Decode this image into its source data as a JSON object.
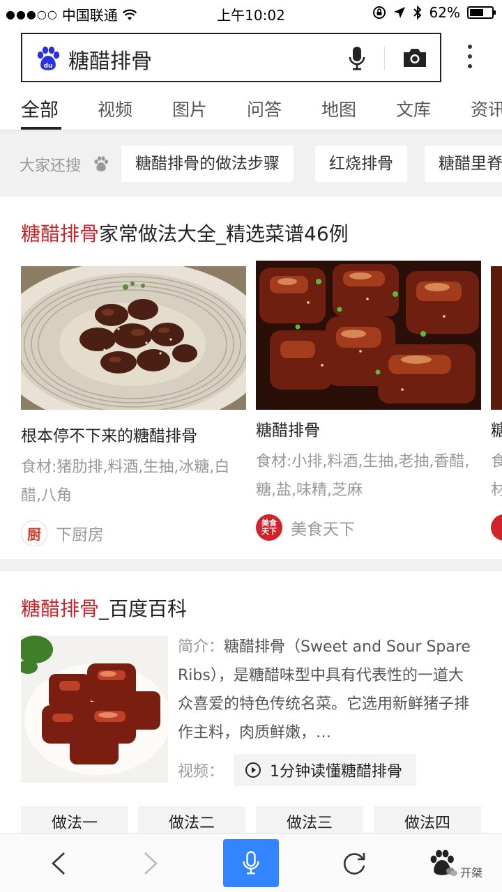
{
  "status_bar": {
    "carrier": "中国联通",
    "time": "上午10:02",
    "battery": "62%",
    "battery_level": 0.62
  },
  "search": {
    "query": "糖醋排骨"
  },
  "tabs": [
    "全部",
    "视频",
    "图片",
    "问答",
    "地图",
    "文库",
    "资讯"
  ],
  "active_tab": 0,
  "suggestions": {
    "label": "大家还搜",
    "items": [
      "糖醋排骨的做法步骤",
      "红烧排骨",
      "糖醋里脊"
    ]
  },
  "recipes_card": {
    "title_highlight": "糖醋排骨",
    "title_rest": "家常做法大全_精选菜谱46例",
    "items": [
      {
        "name": "根本停不下来的糖醋排骨",
        "ingredients": "食材:猪肋排,料酒,生抽,冰糖,白醋,八角",
        "source": "下厨房",
        "source_logo": "厨"
      },
      {
        "name": "糖醋排骨",
        "ingredients": "食材:小排,料酒,生抽,老抽,香醋,糖,盐,味精,芝麻",
        "source": "美食天下",
        "source_logo": "美食天下"
      },
      {
        "name": "糖醋排骨",
        "ingredients": "食材:排骨,糖",
        "source": "",
        "source_logo": ""
      }
    ]
  },
  "baike_card": {
    "title_highlight": "糖醋排骨",
    "title_rest": "_百度百科",
    "intro_label": "简介：",
    "intro": "糖醋排骨（Sweet and Sour Spare Ribs），是糖醋味型中具有代表性的一道大众喜爱的特色传统名菜。它选用新鲜猪子排作主料，肉质鲜嫩，…",
    "video_label": "视频：",
    "video_title": "1分钟读懂糖醋排骨",
    "methods": [
      "做法一",
      "做法二",
      "做法三",
      "做法四"
    ]
  },
  "watermark": "开桀",
  "colors": {
    "highlight_red": "#c8252a",
    "mic_blue": "#3385ff",
    "baidu_blue": "#2932e1"
  }
}
